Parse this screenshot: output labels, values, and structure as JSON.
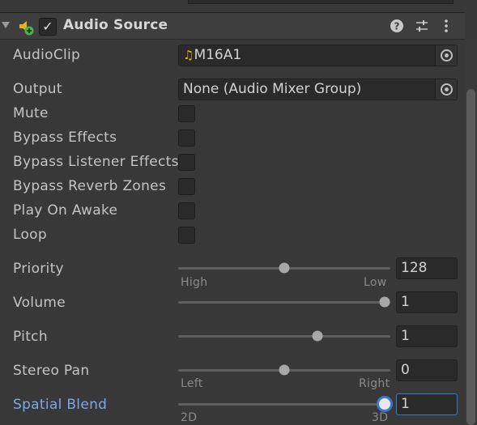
{
  "component": {
    "title": "Audio Source",
    "enabled": true,
    "enabled_glyph": "✓"
  },
  "header_icons": [
    "help-icon",
    "presets-icon",
    "more-options-icon"
  ],
  "fields": {
    "audio_clip": {
      "label": "AudioClip",
      "value": "M16A1",
      "icon": "music-note-icon",
      "icon_glyph": "♫"
    },
    "output": {
      "label": "Output",
      "value": "None (Audio Mixer Group)"
    }
  },
  "toggles": [
    {
      "id": "mute",
      "label": "Mute",
      "checked": false
    },
    {
      "id": "bypass-effects",
      "label": "Bypass Effects",
      "checked": false
    },
    {
      "id": "bypass-listener-effects",
      "label": "Bypass Listener Effects",
      "checked": false
    },
    {
      "id": "bypass-reverb-zones",
      "label": "Bypass Reverb Zones",
      "checked": false
    },
    {
      "id": "play-on-awake",
      "label": "Play On Awake",
      "checked": false
    },
    {
      "id": "loop",
      "label": "Loop",
      "checked": false
    }
  ],
  "sliders": {
    "priority": {
      "label": "Priority",
      "value": "128",
      "min": 0,
      "max": 256,
      "num": 128,
      "min_label": "High",
      "max_label": "Low"
    },
    "volume": {
      "label": "Volume",
      "value": "1",
      "min": 0,
      "max": 1,
      "num": 1
    },
    "pitch": {
      "label": "Pitch",
      "value": "1",
      "min": -3,
      "max": 3,
      "num": 1
    },
    "stereo_pan": {
      "label": "Stereo Pan",
      "value": "0",
      "min": -1,
      "max": 1,
      "num": 0,
      "min_label": "Left",
      "max_label": "Right"
    },
    "spatial_blend": {
      "label": "Spatial Blend",
      "value": "1",
      "min": 0,
      "max": 1,
      "num": 1,
      "min_label": "2D",
      "max_label": "3D",
      "focused": true
    }
  },
  "colors": {
    "focus": "#3a79c9",
    "focused_label": "#7ba7e8",
    "audio_icon": "#e3b31f",
    "add_badge": "#4caf50"
  }
}
